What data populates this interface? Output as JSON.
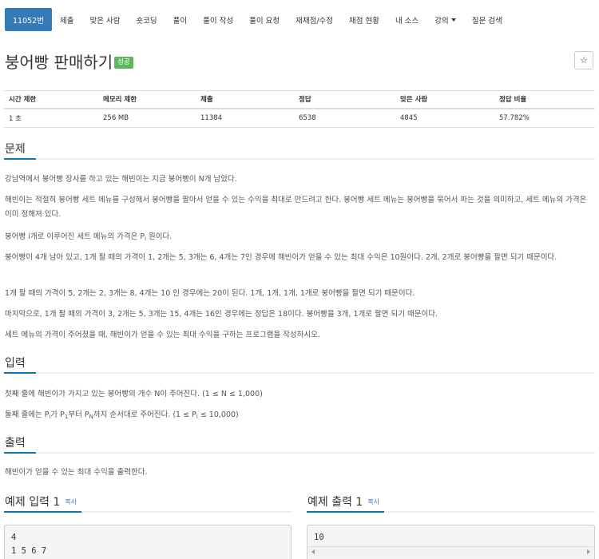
{
  "nav": {
    "items": [
      {
        "label": "11052번",
        "active": true
      },
      {
        "label": "제출"
      },
      {
        "label": "맞은 사람"
      },
      {
        "label": "숏코딩"
      },
      {
        "label": "풀이"
      },
      {
        "label": "풀이 작성"
      },
      {
        "label": "풀이 요청"
      },
      {
        "label": "재채점/수정"
      },
      {
        "label": "채점 현황"
      },
      {
        "label": "내 소스"
      },
      {
        "label": "강의"
      },
      {
        "label": "질문 검색"
      }
    ]
  },
  "problem": {
    "title": "붕어빵 판매하기",
    "badge": "성공",
    "star_icon": "star-icon"
  },
  "stats": {
    "headers": [
      "시간 제한",
      "메모리 제한",
      "제출",
      "정답",
      "맞은 사람",
      "정답 비율"
    ],
    "values": [
      "1 초",
      "256 MB",
      "11384",
      "6538",
      "4845",
      "57.782%"
    ]
  },
  "sections": {
    "problem_heading": "문제",
    "p1": "강남역에서 붕어빵 장사를 하고 있는 해빈이는 지금 붕어빵이 N개 남았다.",
    "p2": "해빈이는 적절히 붕어빵 세트 메뉴를 구성해서 붕어빵을 팔아서 얻을 수 있는 수익을 최대로 만드려고 한다. 붕어빵 세트 메뉴는 붕어빵을 묶어서 파는 것을 의미하고, 세트 메뉴의 가격은 이미 정해져 있다.",
    "p3_a": "붕어빵 i개로 이루어진 세트 메뉴의 가격은 P",
    "p3_sub": "i",
    "p3_b": " 원이다.",
    "p4": "붕어빵이 4개 남아 있고, 1개 팔 때의 가격이 1, 2개는 5, 3개는 6, 4개는 7인 경우에 해빈이가 얻을 수 있는 최대 수익은 10원이다. 2개, 2개로 붕어빵을 팔면 되기 때문이다.",
    "p5": "1개 팔 때의 가격이 5, 2개는 2, 3개는 8, 4개는 10 인 경우에는 20이 된다. 1개, 1개, 1개, 1개로 붕어빵을 팔면 되기 때문이다.",
    "p6": "마지막으로, 1개 팔 때의 가격이 3, 2개는 5, 3개는 15, 4개는 16인 경우에는 정답은 18이다. 붕어빵을 3개, 1개로 팔면 되기 때문이다.",
    "p7": "세트 메뉴의 가격이 주어졌을 때, 해빈이가 얻을 수 있는 최대 수익을 구하는 프로그램을 작성하시오.",
    "input_heading": "입력",
    "in1": "첫째 줄에 해빈이가 가지고 있는 붕어빵의 개수 N이 주어진다. (1 ≤ N ≤ 1,000)",
    "in2_a": "둘째 줄에는 P",
    "in2_sub1": "i",
    "in2_b": "가 P",
    "in2_sub2": "1",
    "in2_c": "부터 P",
    "in2_sub3": "N",
    "in2_d": "까지 순서대로 주어진다. (1 ≤ P",
    "in2_sub4": "i",
    "in2_e": " ≤ 10,000)",
    "output_heading": "출력",
    "out1": "해빈이가 얻을 수 있는 최대 수익을 출력한다."
  },
  "samples": {
    "input_heading": "예제 입력 1",
    "output_heading": "예제 출력 1",
    "copy_label": "복사",
    "input_text": "4\n1 5 6 7",
    "output_text": "10"
  }
}
